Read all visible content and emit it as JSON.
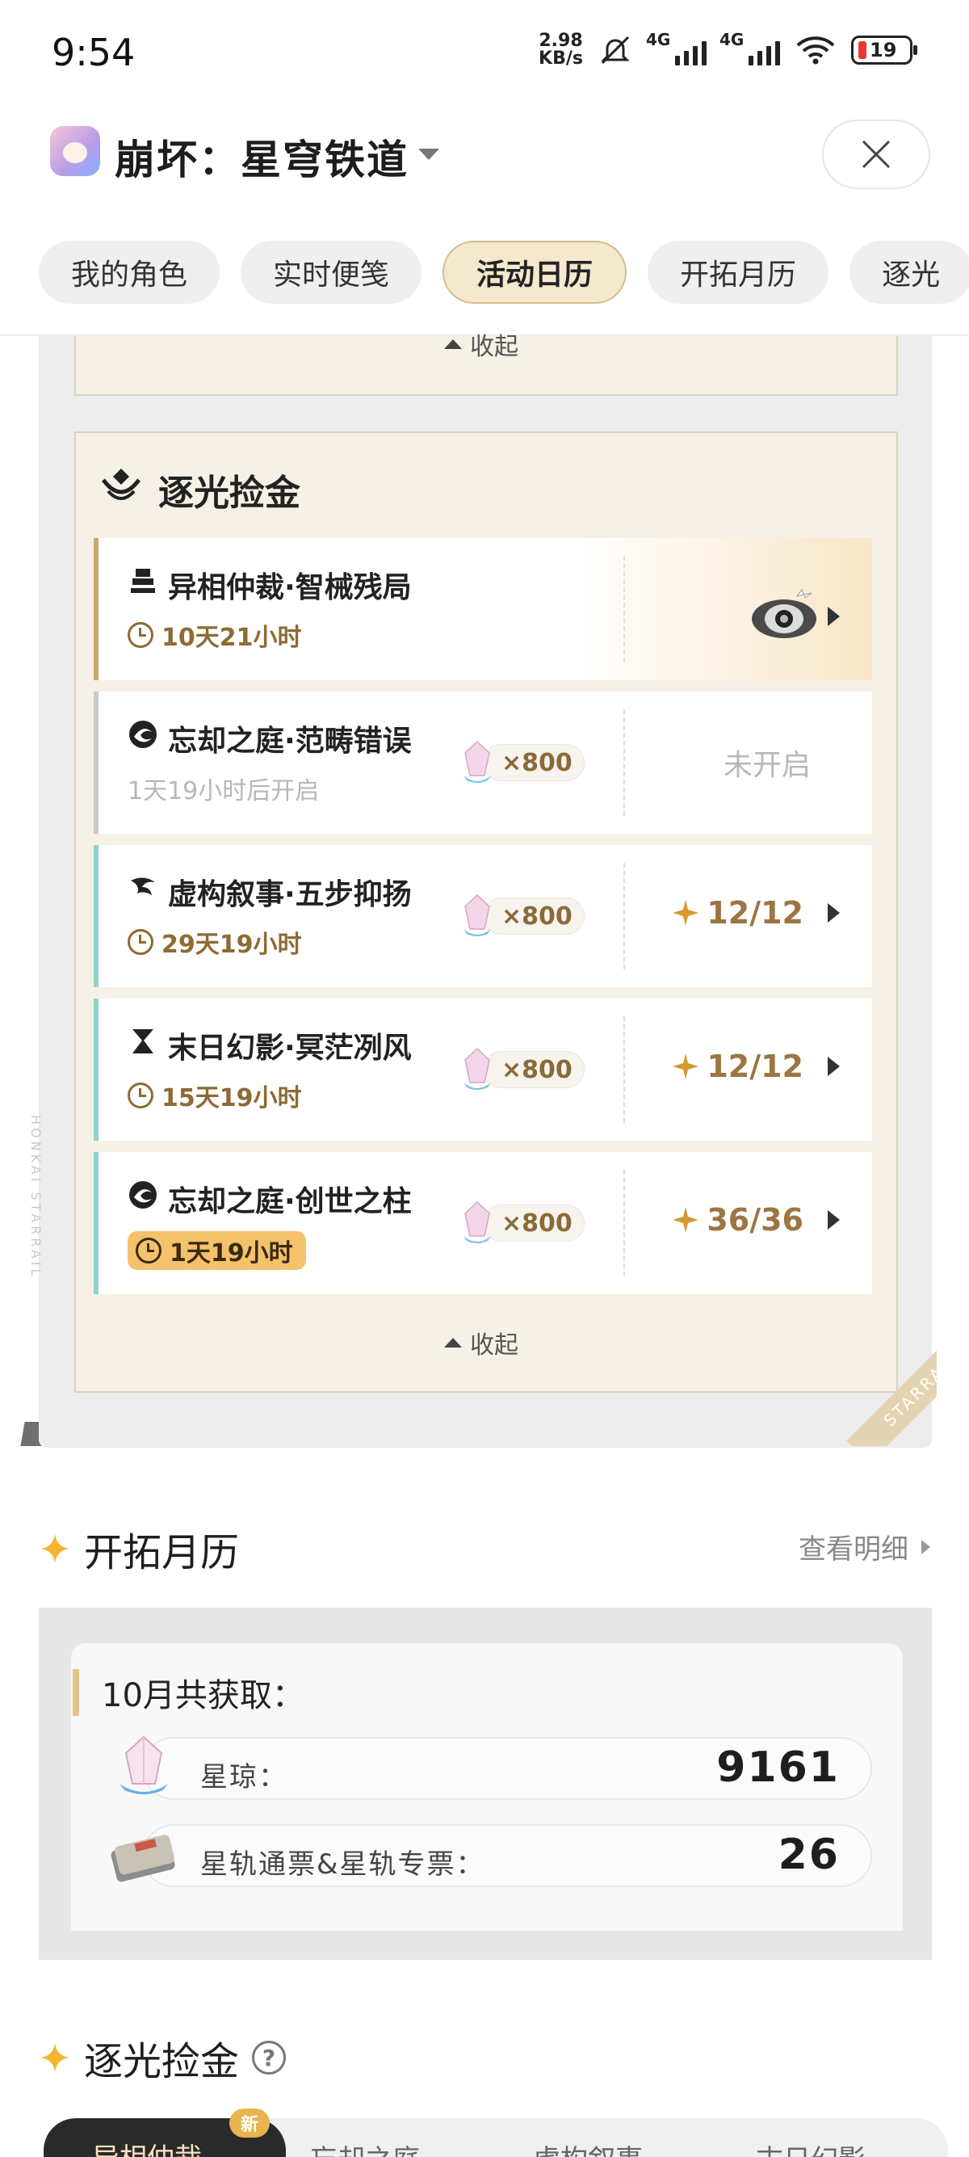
{
  "status_bar": {
    "time": "9:54",
    "net_speed_value": "2.98",
    "net_speed_unit": "KB/s",
    "signal_1_label": "4G",
    "signal_2_label": "4G",
    "battery": "19"
  },
  "header": {
    "app_title": "崩坏：星穹铁道"
  },
  "tabs": [
    {
      "label": "我的角色"
    },
    {
      "label": "实时便笺"
    },
    {
      "label": "活动日历",
      "active": true
    },
    {
      "label": "开拓月历"
    },
    {
      "label": "逐光"
    }
  ],
  "activity_card": {
    "prev_collapse_label": "收起",
    "title": "逐光捡金",
    "collapse_label": "收起",
    "side_text": "HONKAI STARRAIL",
    "corner_text": "STARRAIL",
    "rows": [
      {
        "name": "异相仲裁·智械残局",
        "time": "10天21小时",
        "status": ""
      },
      {
        "name": "忘却之庭·范畴错误",
        "time": "1天19小时后开启",
        "reward": "×800",
        "status": "未开启"
      },
      {
        "name": "虚构叙事·五步抑扬",
        "time": "29天19小时",
        "reward": "×800",
        "status": "12/12"
      },
      {
        "name": "末日幻影·冥茫冽风",
        "time": "15天19小时",
        "reward": "×800",
        "status": "12/12"
      },
      {
        "name": "忘却之庭·创世之柱",
        "time": "1天19小时",
        "reward": "×800",
        "status": "36/36"
      }
    ]
  },
  "monthly": {
    "section_title": "开拓月历",
    "view_detail": "查看明细",
    "month_label": "10月共获取：",
    "stats": [
      {
        "label": "星琼：",
        "value": "9161"
      },
      {
        "label": "星轨通票&星轨专票：",
        "value": "26"
      }
    ]
  },
  "bottom_section": {
    "title": "逐光捡金",
    "help": "?",
    "new_badge": "新",
    "tabs": [
      "异相仲裁",
      "忘却之庭",
      "虚构叙事",
      "末日幻影"
    ]
  },
  "colors": {
    "accent_gold": "#9c7541",
    "active_tab_bg": "#f4e8ce",
    "time_badge": "#f4c26b",
    "card_bg": "#f6f1e6"
  }
}
